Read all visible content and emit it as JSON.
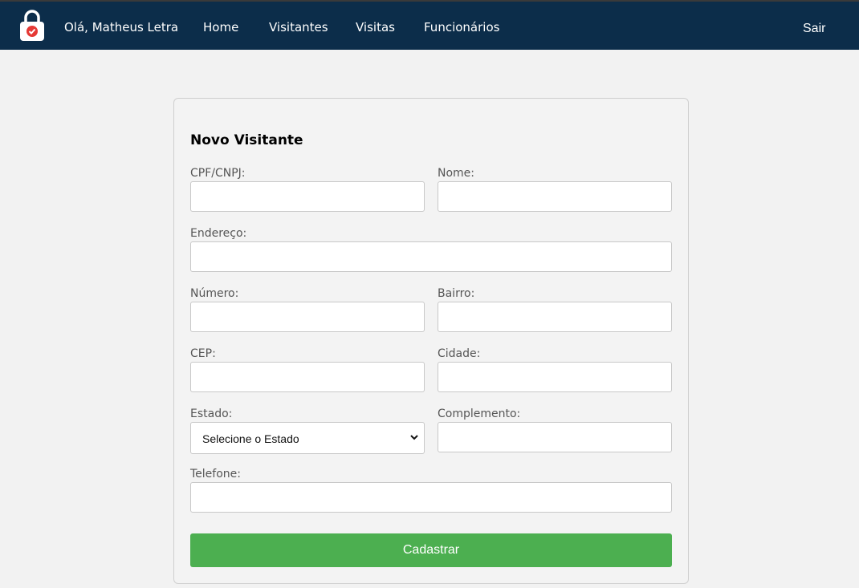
{
  "nav": {
    "greeting": "Olá, Matheus Letra",
    "items": [
      {
        "label": "Home"
      },
      {
        "label": "Visitantes"
      },
      {
        "label": "Visitas"
      },
      {
        "label": "Funcionários"
      }
    ],
    "logout": "Sair"
  },
  "logo": {
    "icon": "padlock-check-icon",
    "lock_color": "#ffffff",
    "badge_color": "#e53935"
  },
  "form": {
    "title": "Novo Visitante",
    "fields": {
      "cpf": {
        "label": "CPF/CNPJ:",
        "value": ""
      },
      "nome": {
        "label": "Nome:",
        "value": ""
      },
      "endereco": {
        "label": "Endereço:",
        "value": ""
      },
      "numero": {
        "label": "Número:",
        "value": ""
      },
      "bairro": {
        "label": "Bairro:",
        "value": ""
      },
      "cep": {
        "label": "CEP:",
        "value": ""
      },
      "cidade": {
        "label": "Cidade:",
        "value": ""
      },
      "estado": {
        "label": "Estado:",
        "selected": "Selecione o Estado"
      },
      "complemento": {
        "label": "Complemento:",
        "value": ""
      },
      "telefone": {
        "label": "Telefone:",
        "value": ""
      }
    },
    "submit": "Cadastrar"
  },
  "colors": {
    "navbar": "#0c2d4a",
    "button": "#4caf50",
    "background": "#f2f2f2"
  }
}
